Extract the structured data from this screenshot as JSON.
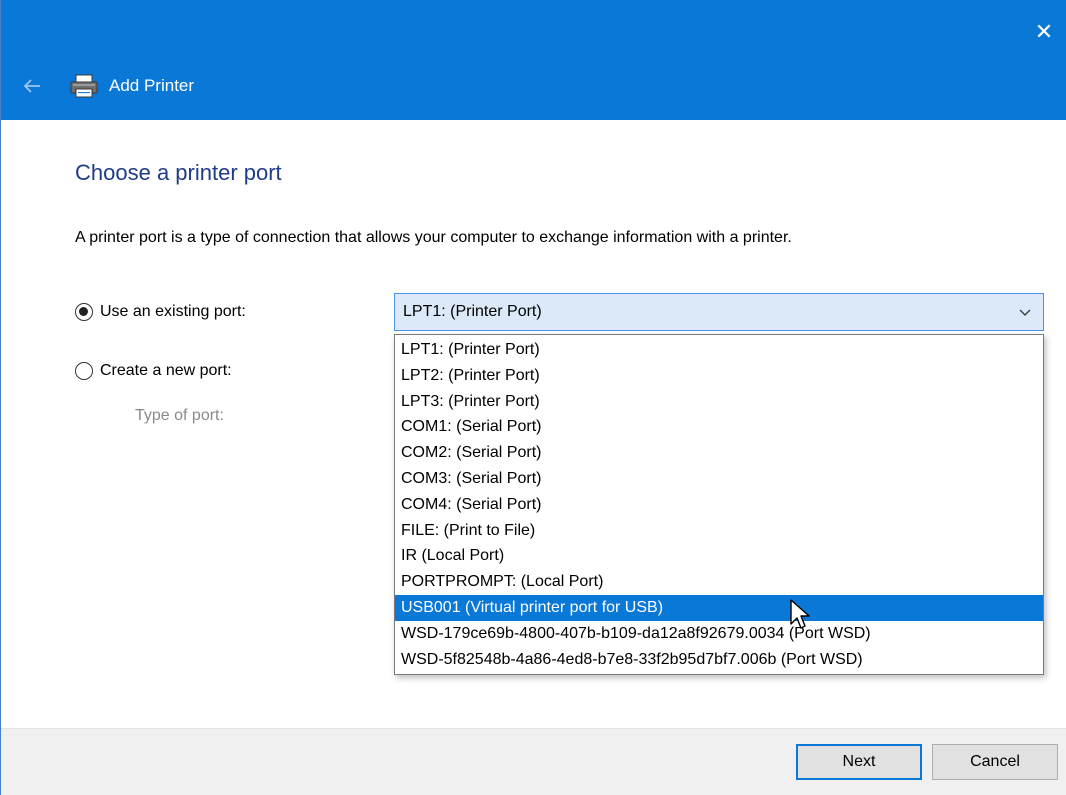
{
  "window": {
    "title": "Add Printer",
    "close_glyph": "✕",
    "accent_color": "#0a78d7"
  },
  "page": {
    "heading": "Choose a printer port",
    "description": "A printer port is a type of connection that allows your computer to exchange information with a printer."
  },
  "options": {
    "existing_port": {
      "label": "Use an existing port:",
      "checked": true
    },
    "new_port": {
      "label": "Create a new port:",
      "checked": false
    },
    "type_of_port_label": "Type of port:"
  },
  "combo": {
    "selected_value": "LPT1: (Printer Port)"
  },
  "dropdown": {
    "items": [
      "LPT1: (Printer Port)",
      "LPT2: (Printer Port)",
      "LPT3: (Printer Port)",
      "COM1: (Serial Port)",
      "COM2: (Serial Port)",
      "COM3: (Serial Port)",
      "COM4: (Serial Port)",
      "FILE: (Print to File)",
      "IR (Local Port)",
      "PORTPROMPT: (Local Port)",
      "USB001 (Virtual printer port for USB)",
      "WSD-179ce69b-4800-407b-b109-da12a8f92679.0034 (Port WSD)",
      "WSD-5f82548b-4a86-4ed8-b7e8-33f2b95d7bf7.006b (Port WSD)"
    ],
    "highlighted_index": 10
  },
  "footer": {
    "next_label": "Next",
    "cancel_label": "Cancel"
  },
  "icons": {
    "back": "back-arrow-icon",
    "printer": "printer-icon",
    "close": "close-icon",
    "dropdown": "chevron-down-icon",
    "cursor": "mouse-pointer-icon"
  }
}
